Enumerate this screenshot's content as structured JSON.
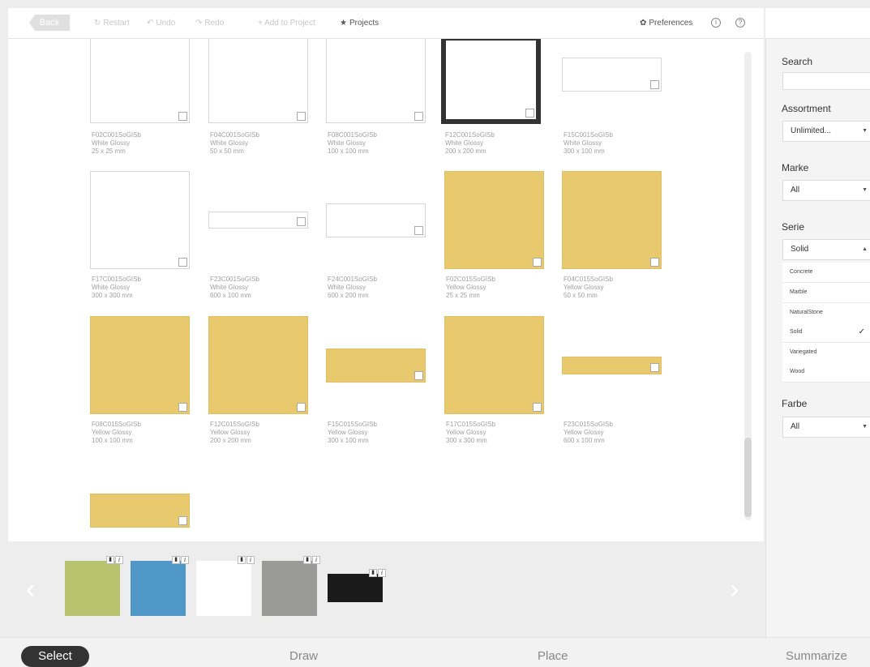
{
  "toolbar": {
    "back": "Back",
    "restart": "Restart",
    "undo": "Undo",
    "redo": "Redo",
    "add_to_project": "+ Add to Project",
    "projects": "Projects",
    "preferences": "Preferences",
    "icons": {
      "restart": "restart-icon",
      "undo": "undo-icon",
      "redo": "redo-icon",
      "projects": "star-icon",
      "preferences": "gear-icon",
      "info": "info-icon",
      "help": "help-icon"
    }
  },
  "tiles": [
    {
      "code": "F02C001SoGISb",
      "finish": "White Glossy",
      "size": "25 x 25 mm",
      "color": "white"
    },
    {
      "code": "F04C001SoGISb",
      "finish": "White Glossy",
      "size": "50 x 50 mm",
      "color": "white"
    },
    {
      "code": "F08C001SoGISb",
      "finish": "White Glossy",
      "size": "100 x 100 mm",
      "color": "white"
    },
    {
      "code": "F12C001SoGISb",
      "finish": "White Glossy",
      "size": "200 x 200 mm",
      "color": "white",
      "selected": true
    },
    {
      "code": "F15C001SoGISb",
      "finish": "White Glossy",
      "size": "300 x 100 mm",
      "color": "white"
    },
    {
      "code": "F17C001SoGISb",
      "finish": "White Glossy",
      "size": "300 x 300 mm",
      "color": "white"
    },
    {
      "code": "F23C001SoGISb",
      "finish": "White Glossy",
      "size": "600 x 100 mm",
      "color": "white"
    },
    {
      "code": "F24C001SoGISb",
      "finish": "White Glossy",
      "size": "600 x 200 mm",
      "color": "white"
    },
    {
      "code": "F02C015SoGISb",
      "finish": "Yellow Glossy",
      "size": "25 x 25 mm",
      "color": "yellow"
    },
    {
      "code": "F04C015SoGISb",
      "finish": "Yellow Glossy",
      "size": "50 x 50 mm",
      "color": "yellow"
    },
    {
      "code": "F08C015SoGISb",
      "finish": "Yellow Glossy",
      "size": "100 x 100 mm",
      "color": "yellow"
    },
    {
      "code": "F12C015SoGISb",
      "finish": "Yellow Glossy",
      "size": "200 x 200 mm",
      "color": "yellow"
    },
    {
      "code": "F15C015SoGISb",
      "finish": "Yellow Glossy",
      "size": "300 x 100 mm",
      "color": "yellow"
    },
    {
      "code": "F17C015SoGISb",
      "finish": "Yellow Glossy",
      "size": "300 x 300 mm",
      "color": "yellow"
    },
    {
      "code": "F23C015SoGISb",
      "finish": "Yellow Glossy",
      "size": "600 x 100 mm",
      "color": "yellow"
    },
    {
      "color": "yellow"
    }
  ],
  "colors": {
    "yellow": "#e8c96d",
    "white": "#ffffff",
    "dark": "#333333"
  },
  "swatches": [
    {
      "color": "#b9c36f",
      "info": "i",
      "trash_icon": "trash-icon"
    },
    {
      "color": "#4f97c6",
      "info": "i",
      "trash_icon": "trash-icon"
    },
    {
      "color": "#ffffff",
      "info": "i",
      "trash_icon": "trash-icon"
    },
    {
      "color": "#9a9a98",
      "info": "i",
      "trash_icon": "trash-icon"
    },
    {
      "color": "#1a1a1a",
      "info": "i",
      "trash_icon": "trash-icon"
    }
  ],
  "sidebar": {
    "search_label": "Search",
    "search_value": "",
    "assortment_label": "Assortment",
    "assortment_value": "Unlimited...",
    "marke_label": "Marke",
    "marke_value": "All",
    "serie_label": "Serie",
    "serie_value": "Solid",
    "serie_options": [
      "Concrete",
      "Marble",
      "NaturalStone",
      "Solid",
      "Variegated",
      "Wood"
    ],
    "serie_checked": "Solid",
    "farbe_label": "Farbe",
    "farbe_value": "All"
  },
  "nav": {
    "select": "Select",
    "draw": "Draw",
    "place": "Place",
    "summarize": "Summarize"
  }
}
